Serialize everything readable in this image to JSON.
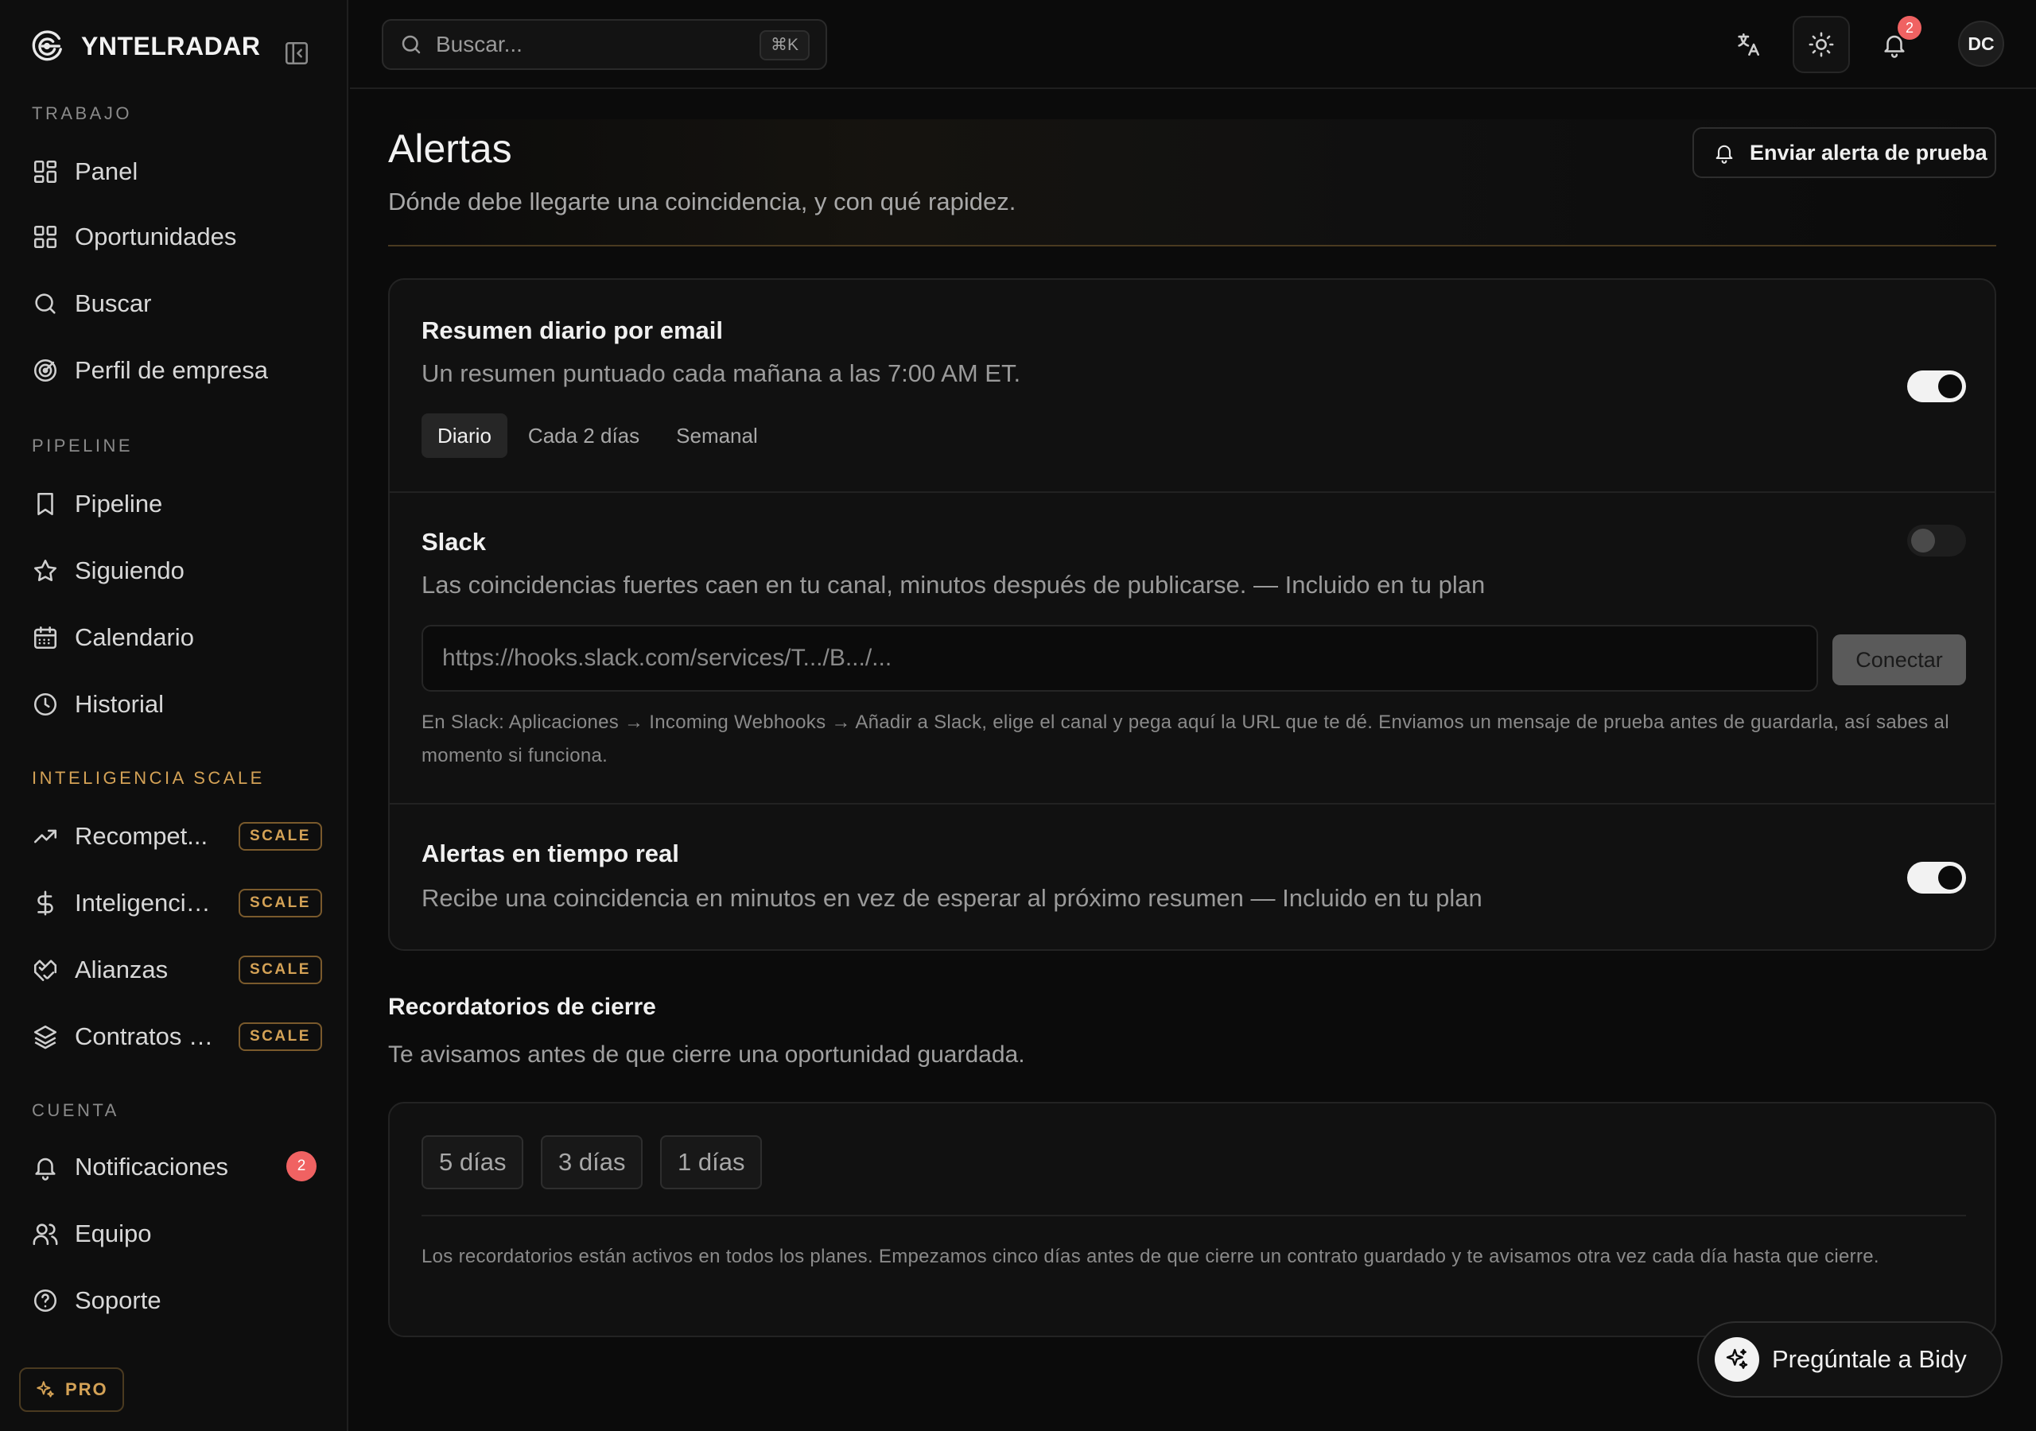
{
  "app": {
    "brand": "YNTELRADAR"
  },
  "sidebar": {
    "sections": [
      {
        "label": "TRABAJO"
      },
      {
        "label": "PIPELINE"
      },
      {
        "label": "INTELIGENCIA SCALE"
      },
      {
        "label": "CUENTA"
      }
    ],
    "items": [
      {
        "label": "Panel",
        "icon": "layout-grid-icon"
      },
      {
        "label": "Oportunidades",
        "icon": "grid-icon"
      },
      {
        "label": "Buscar",
        "icon": "search-icon"
      },
      {
        "label": "Perfil de empresa",
        "icon": "target-icon"
      },
      {
        "label": "Pipeline",
        "icon": "bookmark-icon"
      },
      {
        "label": "Siguiendo",
        "icon": "star-icon"
      },
      {
        "label": "Calendario",
        "icon": "calendar-icon"
      },
      {
        "label": "Historial",
        "icon": "clock-icon"
      },
      {
        "label": "Recompet...",
        "icon": "trending-up-icon",
        "badge": "SCALE"
      },
      {
        "label": "Inteligencia...",
        "icon": "dollar-icon",
        "badge": "SCALE"
      },
      {
        "label": "Alianzas",
        "icon": "handshake-icon",
        "badge": "SCALE"
      },
      {
        "label": "Contratos p...",
        "icon": "layers-icon",
        "badge": "SCALE"
      },
      {
        "label": "Notificaciones",
        "icon": "bell-icon",
        "count": "2"
      },
      {
        "label": "Equipo",
        "icon": "users-icon"
      },
      {
        "label": "Soporte",
        "icon": "help-circle-icon"
      }
    ],
    "pro_label": "PRO"
  },
  "topbar": {
    "search_placeholder": "Buscar...",
    "search_shortcut": "⌘K",
    "notifications_count": "2",
    "avatar_initials": "DC"
  },
  "page": {
    "title": "Alertas",
    "subtitle": "Dónde debe llegarte una coincidencia, y con qué rapidez.",
    "test_button": "Enviar alerta de prueba"
  },
  "email_digest": {
    "title": "Resumen diario por email",
    "description": "Un resumen puntuado cada mañana a las 7:00 AM ET.",
    "enabled": true,
    "frequencies": [
      "Diario",
      "Cada 2 días",
      "Semanal"
    ],
    "selected_frequency": "Diario"
  },
  "slack": {
    "title": "Slack",
    "description": "Las coincidencias fuertes caen en tu canal, minutos después de publicarse. — Incluido en tu plan",
    "enabled": false,
    "webhook_placeholder": "https://hooks.slack.com/services/T.../B.../...",
    "connect_label": "Conectar",
    "help": "En Slack: Aplicaciones → Incoming Webhooks → Añadir a Slack, elige el canal y pega aquí la URL que te dé. Enviamos un mensaje de prueba antes de guardarla, así sabes al momento si funciona."
  },
  "realtime": {
    "title": "Alertas en tiempo real",
    "description": "Recibe una coincidencia en minutos en vez de esperar al próximo resumen — Incluido en tu plan",
    "enabled": true
  },
  "reminders": {
    "title": "Recordatorios de cierre",
    "subtitle": "Te avisamos antes de que cierre una oportunidad guardada.",
    "options": [
      "5 días",
      "3 días",
      "1 días"
    ],
    "note": "Los recordatorios están activos en todos los planes. Empezamos cinco días antes de que cierre un contrato guardado y te avisamos otra vez cada día hasta que cierre."
  },
  "assistant": {
    "label": "Pregúntale a Bidy"
  }
}
